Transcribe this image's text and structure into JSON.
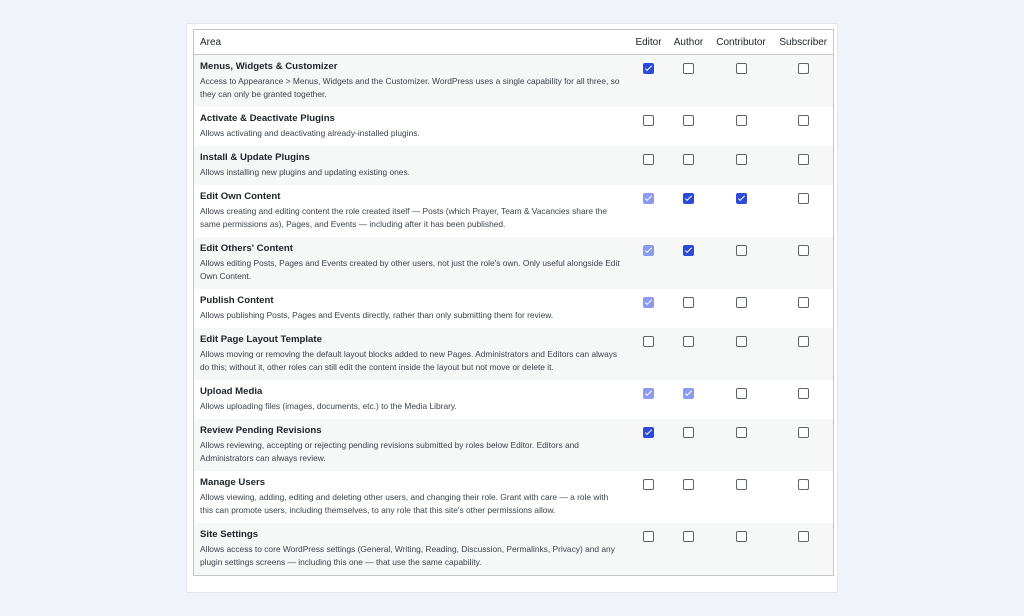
{
  "headers": {
    "area": "Area",
    "editor": "Editor",
    "author": "Author",
    "contributor": "Contributor",
    "subscriber": "Subscriber"
  },
  "rows": [
    {
      "title": "Menus, Widgets & Customizer",
      "desc": "Access to Appearance > Menus, Widgets and the Customizer. WordPress uses a single capability for all three, so they can only be granted together.",
      "states": [
        "checked",
        "unchecked",
        "unchecked",
        "unchecked"
      ]
    },
    {
      "title": "Activate & Deactivate Plugins",
      "desc": "Allows activating and deactivating already-installed plugins.",
      "states": [
        "unchecked",
        "unchecked",
        "unchecked",
        "unchecked"
      ]
    },
    {
      "title": "Install & Update Plugins",
      "desc": "Allows installing new plugins and updating existing ones.",
      "states": [
        "unchecked",
        "unchecked",
        "unchecked",
        "unchecked"
      ]
    },
    {
      "title": "Edit Own Content",
      "desc": "Allows creating and editing content the role created itself — Posts (which Prayer, Team & Vacancies share the same permissions as), Pages, and Events — including after it has been published.",
      "states": [
        "checked-disabled",
        "checked",
        "checked",
        "unchecked"
      ]
    },
    {
      "title": "Edit Others' Content",
      "desc": "Allows editing Posts, Pages and Events created by other users, not just the role's own. Only useful alongside Edit Own Content.",
      "states": [
        "checked-disabled",
        "checked",
        "unchecked",
        "unchecked"
      ]
    },
    {
      "title": "Publish Content",
      "desc": "Allows publishing Posts, Pages and Events directly, rather than only submitting them for review.",
      "states": [
        "checked-disabled",
        "unchecked",
        "unchecked",
        "unchecked"
      ]
    },
    {
      "title": "Edit Page Layout Template",
      "desc": "Allows moving or removing the default layout blocks added to new Pages. Administrators and Editors can always do this; without it, other roles can still edit the content inside the layout but not move or delete it.",
      "states": [
        "unchecked",
        "unchecked",
        "unchecked",
        "unchecked"
      ]
    },
    {
      "title": "Upload Media",
      "desc": "Allows uploading files (images, documents, etc.) to the Media Library.",
      "states": [
        "checked-disabled",
        "checked-disabled",
        "unchecked",
        "unchecked"
      ]
    },
    {
      "title": "Review Pending Revisions",
      "desc": "Allows reviewing, accepting or rejecting pending revisions submitted by roles below Editor. Editors and Administrators can always review.",
      "states": [
        "checked",
        "unchecked",
        "unchecked",
        "unchecked"
      ]
    },
    {
      "title": "Manage Users",
      "desc": "Allows viewing, adding, editing and deleting other users, and changing their role. Grant with care — a role with this can promote users, including themselves, to any role that this site's other permissions allow.",
      "states": [
        "unchecked",
        "unchecked",
        "unchecked",
        "unchecked"
      ]
    },
    {
      "title": "Site Settings",
      "desc": "Allows access to core WordPress settings (General, Writing, Reading, Discussion, Permalinks, Privacy) and any plugin settings screens — including this one — that use the same capability.",
      "states": [
        "unchecked",
        "unchecked",
        "unchecked",
        "unchecked"
      ]
    }
  ],
  "colors": {
    "checked": "#2c4ad9",
    "checked_disabled": "#8a9bf0",
    "row_alt": "#f6f7f7",
    "page_bg": "#f0f3fa"
  }
}
